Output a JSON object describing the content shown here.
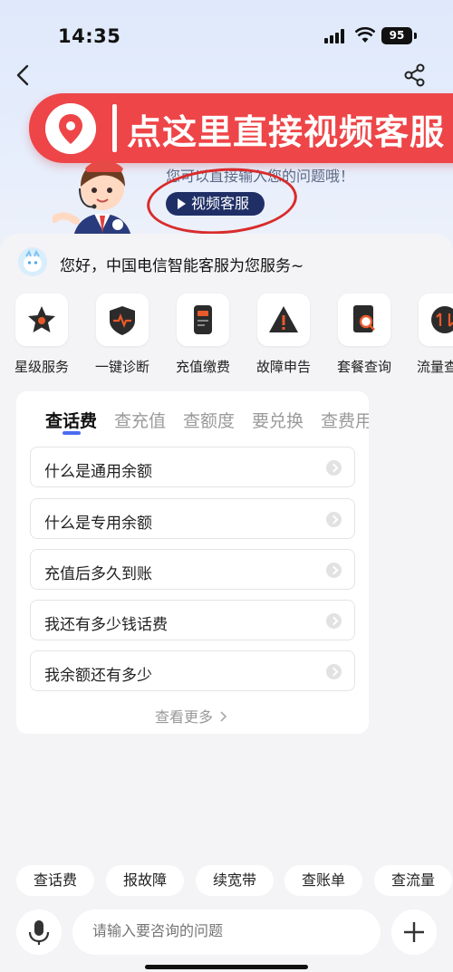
{
  "status_bar": {
    "time": "14:35",
    "battery": "95"
  },
  "banner": {
    "text": "点这里直接视频客服"
  },
  "hero": {
    "hint": "您可以直接输入您的问题哦！",
    "video_button": "视频客服"
  },
  "greeting": "您好，中国电信智能客服为您服务~",
  "services": [
    {
      "label": "星级服务",
      "icon": "star-service-icon"
    },
    {
      "label": "一键诊断",
      "icon": "shield-diagnosis-icon"
    },
    {
      "label": "充值缴费",
      "icon": "phone-recharge-icon"
    },
    {
      "label": "故障申告",
      "icon": "warning-icon"
    },
    {
      "label": "套餐查询",
      "icon": "plan-search-icon"
    },
    {
      "label": "流量查",
      "icon": "data-flow-icon"
    }
  ],
  "faq": {
    "tabs": [
      "查话费",
      "查充值",
      "查额度",
      "要兑换",
      "查费用"
    ],
    "active_tab": "查话费",
    "questions": [
      "什么是通用余额",
      "什么是专用余额",
      "充值后多久到账",
      "我还有多少钱话费",
      "我余额还有多少"
    ],
    "more": "查看更多"
  },
  "quick_chips": [
    "查话费",
    "报故障",
    "续宽带",
    "查账单",
    "查流量"
  ],
  "input": {
    "placeholder": "请输入要咨询的问题"
  },
  "colors": {
    "banner_red": "#ee4548",
    "accent_blue": "#4a6cf0",
    "video_button_navy": "#1f2f66"
  }
}
